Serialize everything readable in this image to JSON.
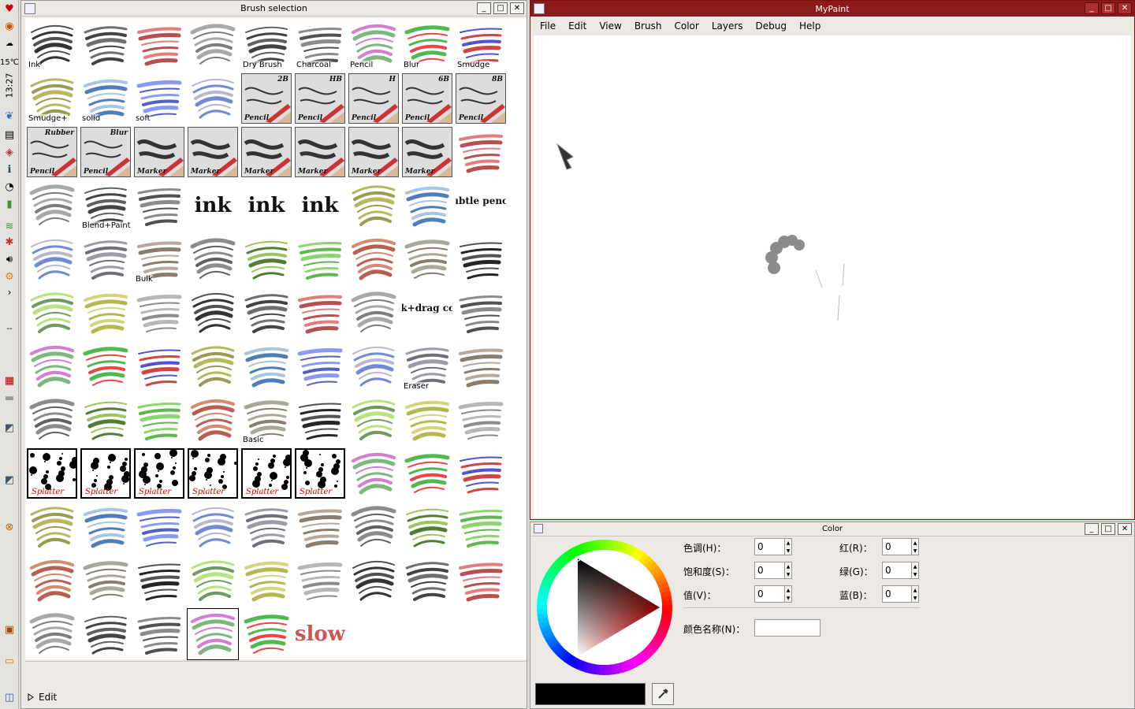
{
  "left_panel": {
    "temperature": "15℃",
    "time": "13:27",
    "collapse_glyph": "›",
    "dashes": "--"
  },
  "brush_window": {
    "title": "Brush selection",
    "buttons": {
      "minimize": "_",
      "maximize": "□",
      "close": "✕"
    },
    "expander_label": "Edit",
    "brushes": [
      {
        "label": "Ink"
      },
      {
        "label": ""
      },
      {
        "label": ""
      },
      {
        "label": ""
      },
      {
        "label": "Dry Brush"
      },
      {
        "label": "Charcoal"
      },
      {
        "label": "Pencil"
      },
      {
        "label": "Blur"
      },
      {
        "label": "Smudge"
      },
      {
        "label": "Smudge+"
      },
      {
        "label": "solid"
      },
      {
        "label": "soft"
      },
      {
        "label": ""
      },
      {
        "card": "Pencil",
        "tag": "2B"
      },
      {
        "card": "Pencil",
        "tag": "HB"
      },
      {
        "card": "Pencil",
        "tag": "H"
      },
      {
        "card": "Pencil",
        "tag": "6B"
      },
      {
        "card": "Pencil",
        "tag": "8B"
      },
      {
        "card": "Pencil",
        "tag": "Rubber"
      },
      {
        "card": "Pencil",
        "tag": "Blur"
      },
      {
        "card": "Marker",
        "tag": ""
      },
      {
        "card": "Marker",
        "tag": ""
      },
      {
        "card": "Marker",
        "tag": ""
      },
      {
        "card": "Marker",
        "tag": ""
      },
      {
        "card": "Marker",
        "tag": ""
      },
      {
        "card": "Marker",
        "tag": ""
      },
      {
        "label": ""
      },
      {
        "label": ""
      },
      {
        "label": "Blend+Paint"
      },
      {
        "label": ""
      },
      {
        "label": "",
        "art": "ink"
      },
      {
        "label": "",
        "art": "ink"
      },
      {
        "label": "",
        "art": "ink"
      },
      {
        "label": ""
      },
      {
        "label": ""
      },
      {
        "label": "",
        "art": "subtle pencil"
      },
      {
        "label": ""
      },
      {
        "label": ""
      },
      {
        "label": "Bulk"
      },
      {
        "label": ""
      },
      {
        "label": ""
      },
      {
        "label": ""
      },
      {
        "label": ""
      },
      {
        "label": ""
      },
      {
        "label": ""
      },
      {
        "label": ""
      },
      {
        "label": ""
      },
      {
        "label": ""
      },
      {
        "label": ""
      },
      {
        "label": ""
      },
      {
        "label": ""
      },
      {
        "label": ""
      },
      {
        "label": "",
        "art": "pick+drag color"
      },
      {
        "label": ""
      },
      {
        "label": ""
      },
      {
        "label": ""
      },
      {
        "label": ""
      },
      {
        "label": ""
      },
      {
        "label": ""
      },
      {
        "label": ""
      },
      {
        "label": ""
      },
      {
        "label": "Eraser"
      },
      {
        "label": ""
      },
      {
        "label": ""
      },
      {
        "label": ""
      },
      {
        "label": ""
      },
      {
        "label": ""
      },
      {
        "label": "Basic"
      },
      {
        "label": ""
      },
      {
        "label": ""
      },
      {
        "label": ""
      },
      {
        "label": ""
      },
      {
        "splatter": "Splatter"
      },
      {
        "splatter": "Splatter"
      },
      {
        "splatter": "Splatter"
      },
      {
        "splatter": "Splatter"
      },
      {
        "splatter": "Splatter"
      },
      {
        "splatter": "Splatter"
      },
      {
        "label": ""
      },
      {
        "label": ""
      },
      {
        "label": ""
      },
      {
        "label": ""
      },
      {
        "label": ""
      },
      {
        "label": ""
      },
      {
        "label": ""
      },
      {
        "label": ""
      },
      {
        "label": ""
      },
      {
        "label": ""
      },
      {
        "label": ""
      },
      {
        "label": ""
      },
      {
        "label": ""
      },
      {
        "label": ""
      },
      {
        "label": ""
      },
      {
        "label": ""
      },
      {
        "label": ""
      },
      {
        "label": ""
      },
      {
        "label": ""
      },
      {
        "label": ""
      },
      {
        "label": ""
      },
      {
        "label": ""
      },
      {
        "label": ""
      },
      {
        "label": ""
      },
      {
        "label": "",
        "selected": true
      },
      {
        "label": ""
      },
      {
        "label": "",
        "art": "slow"
      }
    ]
  },
  "mypaint_window": {
    "title": "MyPaint",
    "menu": [
      "File",
      "Edit",
      "View",
      "Brush",
      "Color",
      "Layers",
      "Debug",
      "Help"
    ]
  },
  "color_window": {
    "title": "Color",
    "hsv": [
      {
        "label": "色调(H)：",
        "value": "0"
      },
      {
        "label": "饱和度(S)：",
        "value": "0"
      },
      {
        "label": "值(V)：",
        "value": "0"
      }
    ],
    "rgb": [
      {
        "label": "红(R)：",
        "value": "0"
      },
      {
        "label": "绿(G)：",
        "value": "0"
      },
      {
        "label": "蓝(B)：",
        "value": "0"
      }
    ],
    "color_name_label": "颜色名称(N)：",
    "color_name_value": "",
    "current_color": "#000000"
  }
}
